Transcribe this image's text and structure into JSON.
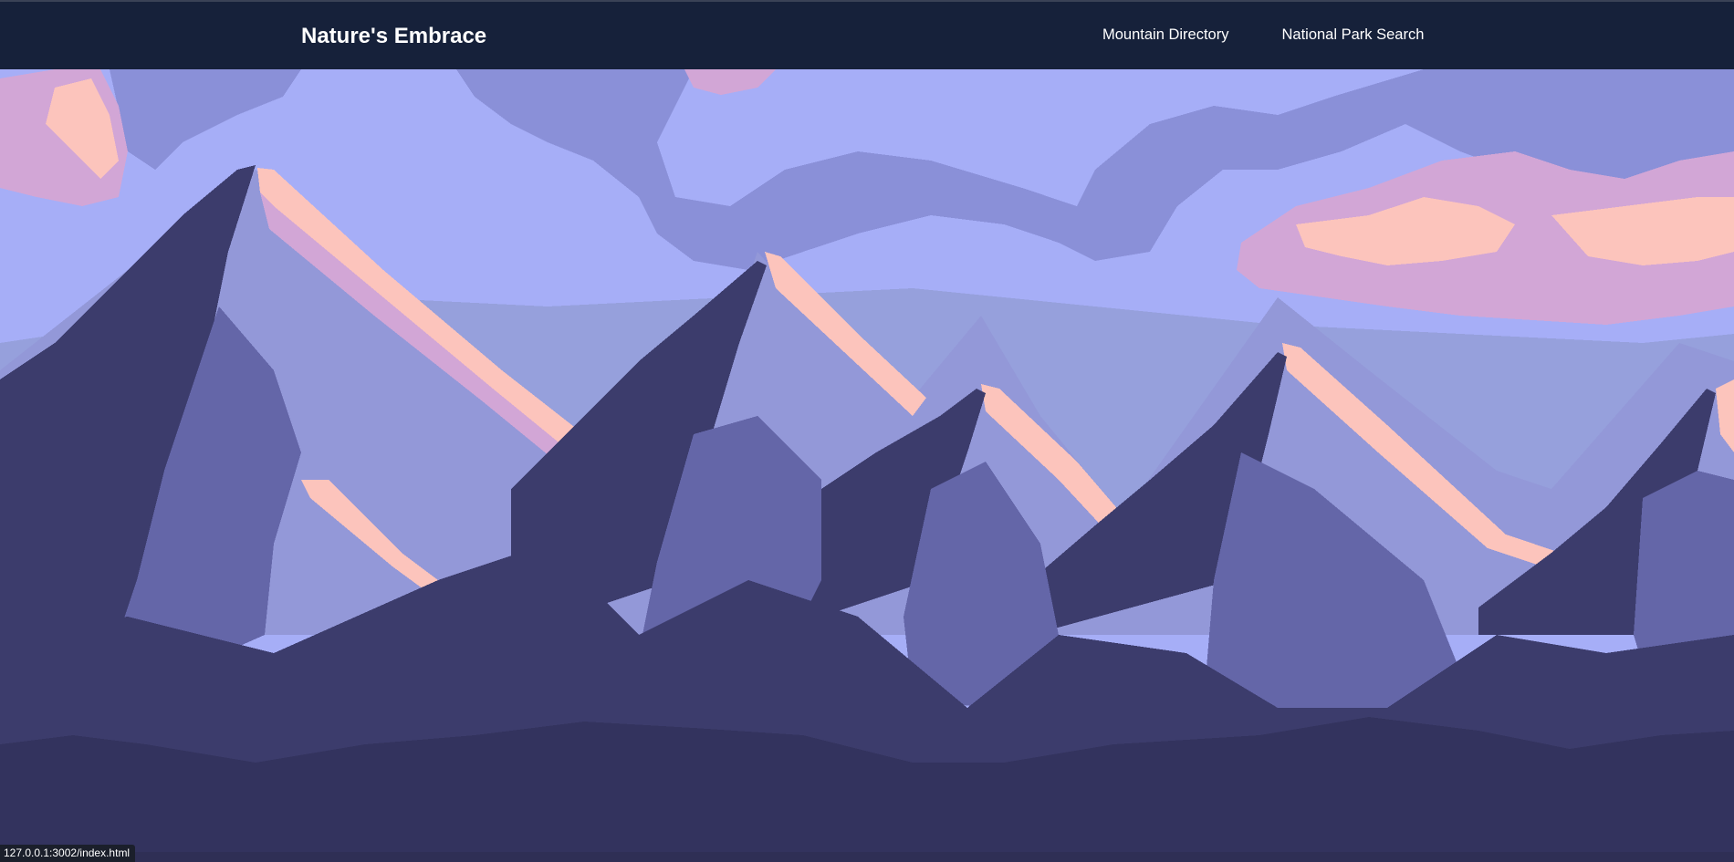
{
  "header": {
    "brand": "Nature's Embrace",
    "nav": [
      {
        "label": "Mountain Directory"
      },
      {
        "label": "National Park Search"
      }
    ]
  },
  "status_bar": {
    "url": "127.0.0.1:3002/index.html"
  },
  "colors": {
    "header_bg": "#16213a",
    "sky_light": "#a6aef7",
    "sky_mid": "#8a90d8",
    "sky_haze": "#96a0dc",
    "cloud_pink": "#d2a6d6",
    "peach": "#fcc4bc",
    "mountain_dark": "#3c3c6c",
    "mountain_mid": "#6466a8",
    "mountain_light": "#9398d8",
    "foreground": "#33335e"
  }
}
